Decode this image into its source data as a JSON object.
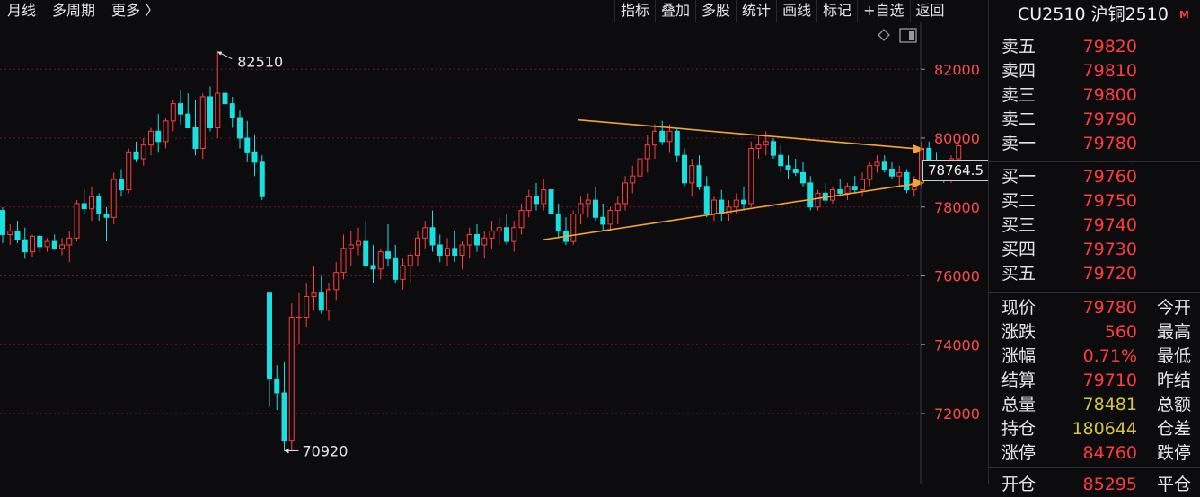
{
  "toolbar": {
    "left": [
      "月线",
      "多周期",
      "更多 〉"
    ],
    "right": [
      "指标",
      "叠加",
      "多股",
      "统计",
      "画线",
      "标记",
      "+自选",
      "返回"
    ]
  },
  "symbol": {
    "title": "CU2510 沪铜2510",
    "logo": "M"
  },
  "orderbook": {
    "asks": [
      {
        "label": "卖五",
        "price": "79820"
      },
      {
        "label": "卖四",
        "price": "79810"
      },
      {
        "label": "卖三",
        "price": "79800"
      },
      {
        "label": "卖二",
        "price": "79790"
      },
      {
        "label": "卖一",
        "price": "79780"
      }
    ],
    "bids": [
      {
        "label": "买一",
        "price": "79760"
      },
      {
        "label": "买二",
        "price": "79750"
      },
      {
        "label": "买三",
        "price": "79740"
      },
      {
        "label": "买四",
        "price": "79730"
      },
      {
        "label": "买五",
        "price": "79720"
      }
    ]
  },
  "quote": [
    {
      "label": "现价",
      "value": "79780",
      "color": "red",
      "rlabel": "今开"
    },
    {
      "label": "涨跌",
      "value": "560",
      "color": "red",
      "rlabel": "最高"
    },
    {
      "label": "涨幅",
      "value": "0.71%",
      "color": "red",
      "rlabel": "最低"
    },
    {
      "label": "结算",
      "value": "79710",
      "color": "red",
      "rlabel": "昨结"
    },
    {
      "label": "总量",
      "value": "78481",
      "color": "yellow",
      "rlabel": "总额"
    },
    {
      "label": "持仓",
      "value": "180644",
      "color": "yellow",
      "rlabel": "仓差"
    },
    {
      "label": "涨停",
      "value": "84760",
      "color": "red",
      "rlabel": "跌停"
    }
  ],
  "quote_cutoff_row": {
    "label": "开仓",
    "value": "85295",
    "rlabel": "平仓"
  },
  "crosshair_price": "78764.5",
  "chart_data": {
    "type": "candlestick",
    "ylim": [
      70000,
      83300
    ],
    "yticks": [
      72000,
      74000,
      76000,
      78000,
      80000,
      82000
    ],
    "ytick_labels": [
      "72000",
      "74000",
      "76000",
      "78000",
      "80000",
      "82000"
    ],
    "annotations": [
      {
        "text": "82510",
        "value": 82510,
        "type": "high"
      },
      {
        "text": "70920",
        "value": 70920,
        "type": "low"
      }
    ],
    "trendlines": [
      {
        "name": "upper",
        "from": 80530,
        "to": 79680
      },
      {
        "name": "lower",
        "from": 77050,
        "to": 78700
      }
    ],
    "up_color": "#ff3b3b",
    "down_color": "#19e0e0",
    "trendline_color": "#f3a531",
    "candles": [
      [
        77900,
        77990,
        76950,
        77200
      ],
      [
        77200,
        77500,
        76900,
        77300
      ],
      [
        77300,
        77600,
        76950,
        77050
      ],
      [
        77050,
        77400,
        76500,
        76700
      ],
      [
        76700,
        77200,
        76550,
        77150
      ],
      [
        77150,
        77200,
        76700,
        76850
      ],
      [
        76850,
        77100,
        76700,
        77000
      ],
      [
        77000,
        77200,
        76750,
        76800
      ],
      [
        76800,
        77100,
        76600,
        76900
      ],
      [
        76900,
        77300,
        76400,
        77100
      ],
      [
        77100,
        78200,
        77000,
        78100
      ],
      [
        78100,
        78500,
        77800,
        77950
      ],
      [
        77950,
        78600,
        77600,
        78300
      ],
      [
        78300,
        78400,
        77600,
        77800
      ],
      [
        77800,
        78000,
        77000,
        77700
      ],
      [
        77700,
        79000,
        77500,
        78800
      ],
      [
        78800,
        79100,
        78300,
        78500
      ],
      [
        78500,
        79700,
        78400,
        79600
      ],
      [
        79600,
        79900,
        79300,
        79400
      ],
      [
        79400,
        80000,
        79200,
        79800
      ],
      [
        79800,
        80300,
        79500,
        80200
      ],
      [
        80200,
        80700,
        79600,
        79900
      ],
      [
        79900,
        80600,
        79700,
        80500
      ],
      [
        80500,
        81100,
        80200,
        81000
      ],
      [
        81000,
        81400,
        80400,
        80700
      ],
      [
        80700,
        81300,
        80300,
        80300
      ],
      [
        80300,
        81100,
        79500,
        79700
      ],
      [
        79700,
        81300,
        79400,
        81200
      ],
      [
        81200,
        81500,
        80200,
        80300
      ],
      [
        80300,
        82510,
        80000,
        81300
      ],
      [
        81300,
        81600,
        80800,
        81000
      ],
      [
        81000,
        81200,
        80300,
        80600
      ],
      [
        80600,
        80800,
        79700,
        80000
      ],
      [
        80000,
        80500,
        79300,
        79600
      ],
      [
        79600,
        80100,
        78900,
        79300
      ],
      [
        79300,
        79500,
        78200,
        78300
      ],
      [
        75500,
        75300,
        72200,
        73000
      ],
      [
        73000,
        73400,
        72100,
        72600
      ],
      [
        72600,
        73500,
        70920,
        71200
      ],
      [
        71200,
        75200,
        70900,
        74800
      ],
      [
        74800,
        75500,
        74000,
        74800
      ],
      [
        74800,
        75800,
        74500,
        75400
      ],
      [
        75400,
        76300,
        75000,
        75500
      ],
      [
        75500,
        76000,
        74900,
        75000
      ],
      [
        75000,
        75800,
        74700,
        75600
      ],
      [
        75600,
        76400,
        75300,
        76100
      ],
      [
        76100,
        77200,
        75900,
        76800
      ],
      [
        76800,
        77300,
        76300,
        76900
      ],
      [
        76900,
        77400,
        76600,
        77000
      ],
      [
        77000,
        77600,
        76200,
        76300
      ],
      [
        76300,
        76900,
        75800,
        76200
      ],
      [
        76200,
        76800,
        75900,
        76700
      ],
      [
        76700,
        77500,
        76300,
        76500
      ],
      [
        76500,
        76900,
        75800,
        75900
      ],
      [
        75900,
        76500,
        75600,
        76300
      ],
      [
        76300,
        76700,
        75800,
        76600
      ],
      [
        76600,
        77300,
        76300,
        77100
      ],
      [
        77100,
        77600,
        76800,
        77400
      ],
      [
        77400,
        77900,
        76700,
        76900
      ],
      [
        76900,
        77200,
        76400,
        76600
      ],
      [
        76600,
        77100,
        76300,
        76800
      ],
      [
        76800,
        77300,
        76400,
        76600
      ],
      [
        76600,
        77000,
        76200,
        76900
      ],
      [
        76900,
        77400,
        76500,
        77200
      ],
      [
        77200,
        77500,
        76700,
        76900
      ],
      [
        76900,
        77300,
        76500,
        77100
      ],
      [
        77100,
        77600,
        76800,
        77300
      ],
      [
        77300,
        77700,
        76900,
        77400
      ],
      [
        77400,
        77800,
        76900,
        77000
      ],
      [
        77000,
        77600,
        76700,
        77400
      ],
      [
        77400,
        78100,
        77200,
        77900
      ],
      [
        77900,
        78500,
        77700,
        78300
      ],
      [
        78300,
        78700,
        77900,
        78100
      ],
      [
        78100,
        78800,
        77900,
        78500
      ],
      [
        78500,
        78700,
        77700,
        77800
      ],
      [
        77800,
        78100,
        77100,
        77300
      ],
      [
        77300,
        77700,
        76900,
        77000
      ],
      [
        77000,
        77900,
        76900,
        77800
      ],
      [
        77800,
        78300,
        77500,
        78100
      ],
      [
        78100,
        78400,
        77700,
        78200
      ],
      [
        78200,
        78600,
        77600,
        77700
      ],
      [
        77700,
        78100,
        77300,
        77500
      ],
      [
        77500,
        78000,
        77300,
        77900
      ],
      [
        77900,
        78300,
        77500,
        78100
      ],
      [
        78100,
        78900,
        77900,
        78700
      ],
      [
        78700,
        79200,
        78400,
        78900
      ],
      [
        78900,
        79600,
        78500,
        79400
      ],
      [
        79400,
        80100,
        79000,
        79800
      ],
      [
        79800,
        80400,
        79400,
        80200
      ],
      [
        80200,
        80500,
        79800,
        79900
      ],
      [
        79900,
        80400,
        79600,
        80200
      ],
      [
        80200,
        80300,
        79300,
        79500
      ],
      [
        79500,
        79700,
        78600,
        78700
      ],
      [
        78700,
        79400,
        78300,
        79200
      ],
      [
        79200,
        79500,
        78500,
        78600
      ],
      [
        78600,
        78900,
        77700,
        77800
      ],
      [
        77800,
        78300,
        77600,
        78200
      ],
      [
        78200,
        78500,
        77600,
        77800
      ],
      [
        77800,
        78200,
        77600,
        78000
      ],
      [
        78000,
        78400,
        77800,
        78200
      ],
      [
        78200,
        78600,
        77900,
        78100
      ],
      [
        78100,
        79900,
        78000,
        79700
      ],
      [
        79700,
        80100,
        79400,
        79800
      ],
      [
        79800,
        80200,
        79500,
        79900
      ],
      [
        79900,
        80000,
        79400,
        79500
      ],
      [
        79500,
        79800,
        79000,
        79200
      ],
      [
        79200,
        79500,
        78800,
        79100
      ],
      [
        79100,
        79400,
        78900,
        79000
      ],
      [
        79000,
        79300,
        78600,
        78700
      ],
      [
        78700,
        78900,
        77900,
        78000
      ],
      [
        78000,
        78500,
        77900,
        78400
      ],
      [
        78400,
        78700,
        78100,
        78200
      ],
      [
        78200,
        78600,
        78100,
        78500
      ],
      [
        78500,
        78800,
        78300,
        78400
      ],
      [
        78400,
        78700,
        78200,
        78600
      ],
      [
        78600,
        78900,
        78400,
        78500
      ],
      [
        78500,
        79000,
        78300,
        78800
      ],
      [
        78800,
        79300,
        78600,
        79200
      ],
      [
        79200,
        79500,
        79000,
        79300
      ],
      [
        79300,
        79500,
        79000,
        79100
      ],
      [
        79100,
        79300,
        78800,
        78900
      ],
      [
        78900,
        79200,
        78600,
        79000
      ],
      [
        79000,
        79100,
        78400,
        78500
      ],
      [
        78500,
        78900,
        78300,
        78700
      ],
      [
        78700,
        79900,
        78600,
        79700
      ],
      [
        79700,
        79900,
        79100,
        79300
      ],
      [
        79300,
        79600,
        78900,
        79100
      ],
      [
        79100,
        79300,
        78700,
        78800
      ],
      [
        78800,
        79500,
        78700,
        79400
      ],
      [
        79400,
        79900,
        79200,
        79780
      ]
    ]
  }
}
